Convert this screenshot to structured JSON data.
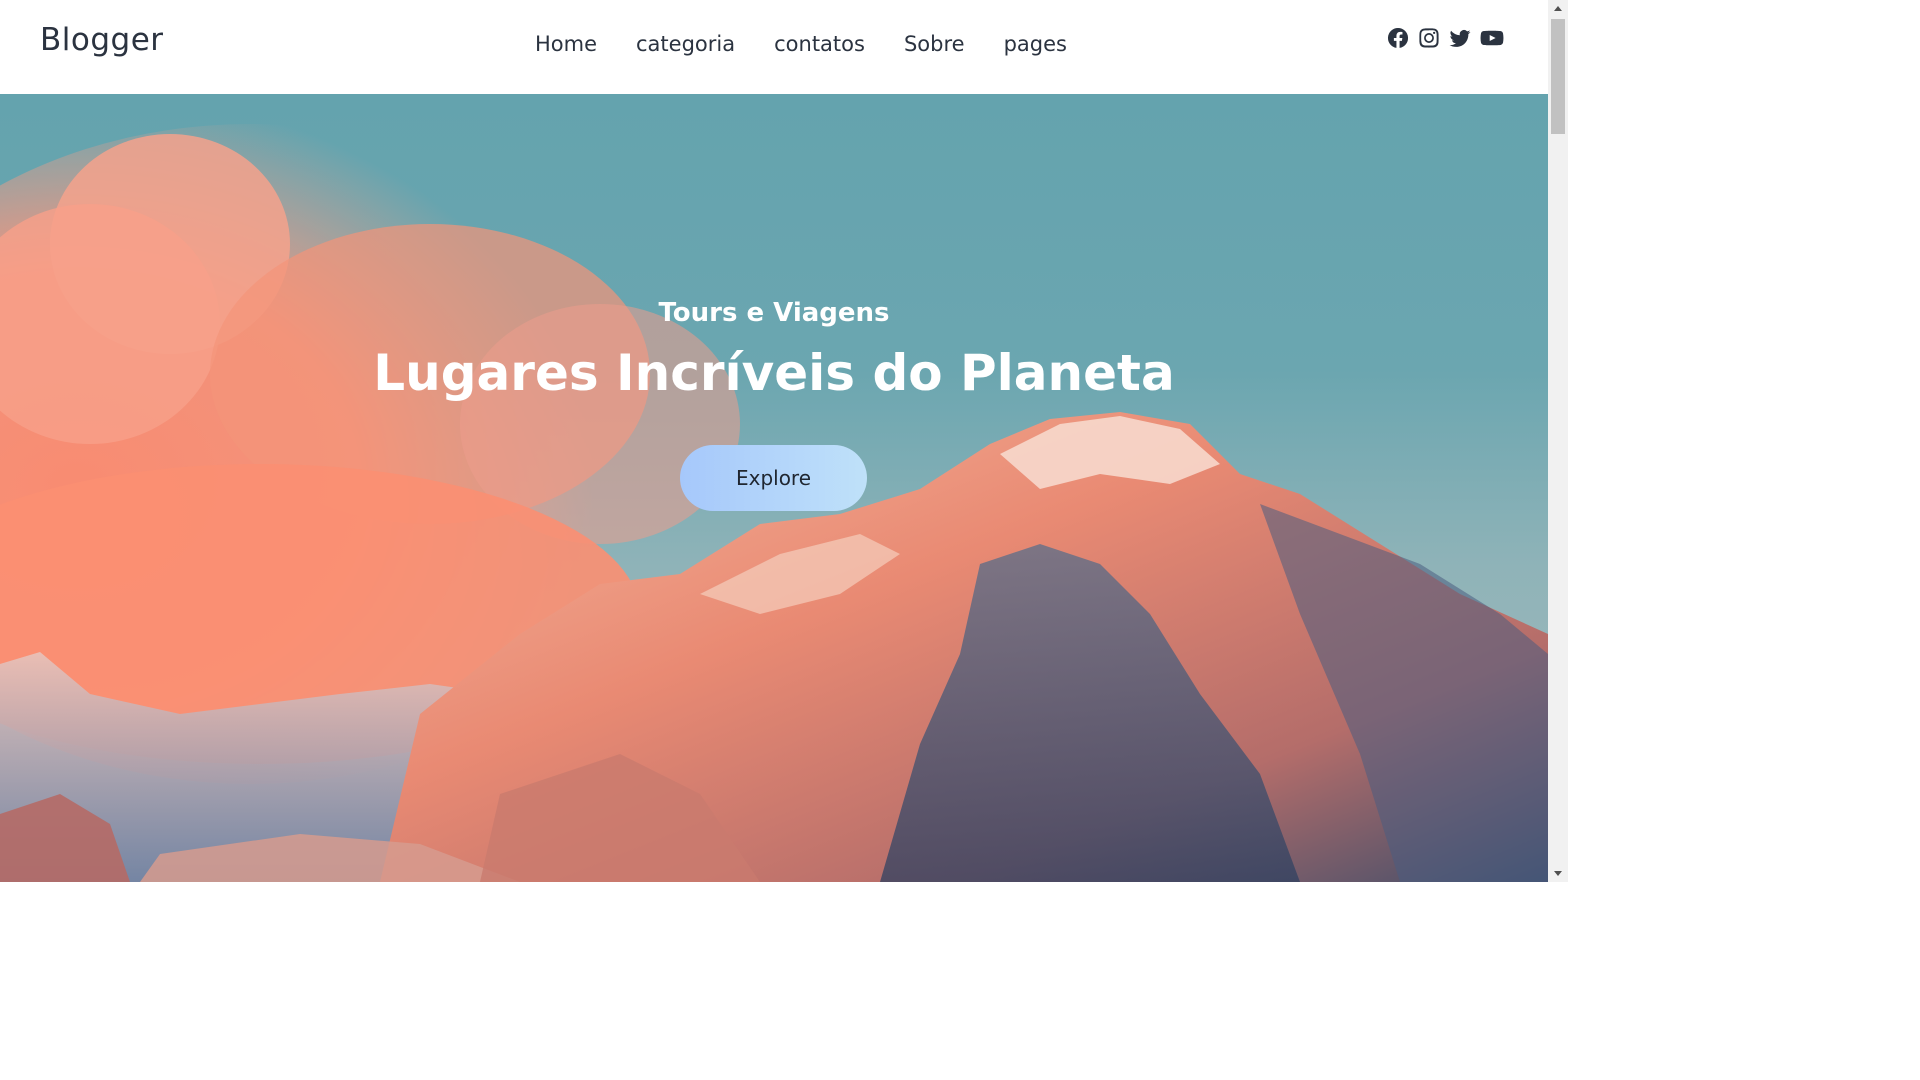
{
  "header": {
    "logo": "Blogger",
    "nav": [
      {
        "label": "Home"
      },
      {
        "label": "categoria"
      },
      {
        "label": "contatos"
      },
      {
        "label": "Sobre"
      },
      {
        "label": "pages"
      }
    ],
    "social_icons": [
      "facebook-icon",
      "instagram-icon",
      "twitter-icon",
      "youtube-icon"
    ]
  },
  "hero": {
    "subtitle": "Tours e Viagens",
    "title": "Lugares Incríveis do Planeta",
    "button_label": "Explore",
    "background": "mountain-sunset-photo"
  },
  "colors": {
    "text_dark": "#2b3340",
    "sky": "#64a3ae",
    "button_start": "#a6c8fb",
    "button_end": "#bfe1f9"
  }
}
